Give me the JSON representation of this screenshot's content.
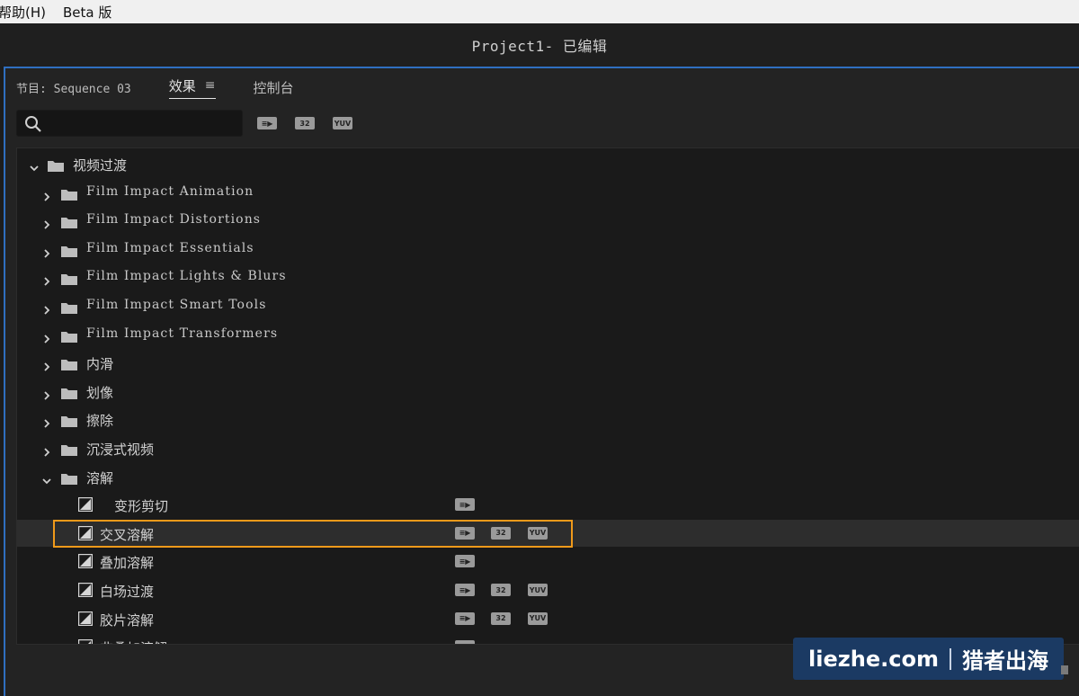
{
  "menu": {
    "items": [
      "帮助(H)",
      "Beta 版"
    ]
  },
  "window": {
    "title": "Project1- 已编辑"
  },
  "panel": {
    "tabs": {
      "program": "节目: Sequence 03",
      "effects": "效果",
      "console": "控制台"
    }
  },
  "search": {
    "value": "",
    "placeholder": ""
  },
  "filter_badges": {
    "accelerated": "≡▶",
    "bit32": "32",
    "yuv": "YUV"
  },
  "tree": {
    "root": "视频过渡",
    "folders": [
      "Film Impact Animation",
      "Film Impact Distortions",
      "Film Impact Essentials",
      "Film Impact Lights & Blurs",
      "Film Impact Smart Tools",
      "Film Impact Transformers",
      "内滑",
      "划像",
      "擦除",
      "沉浸式视频",
      "溶解"
    ],
    "items": [
      {
        "label": "变形剪切",
        "badges": [
          "accelerated"
        ]
      },
      {
        "label": "交叉溶解",
        "badges": [
          "accelerated",
          "bit32",
          "yuv"
        ],
        "selected": true
      },
      {
        "label": "叠加溶解",
        "badges": [
          "accelerated"
        ]
      },
      {
        "label": "白场过渡",
        "badges": [
          "accelerated",
          "bit32",
          "yuv"
        ]
      },
      {
        "label": "胶片溶解",
        "badges": [
          "accelerated",
          "bit32",
          "yuv"
        ]
      },
      {
        "label": "非叠加溶解",
        "badges": [
          "accelerated"
        ]
      }
    ]
  },
  "colors": {
    "selection_outline": "#f09a1a",
    "panel_focus": "#2f6fc0",
    "watermark_bg": "#1b3a63"
  },
  "watermark": {
    "left": "liezhe.com",
    "right": "猎者出海"
  }
}
